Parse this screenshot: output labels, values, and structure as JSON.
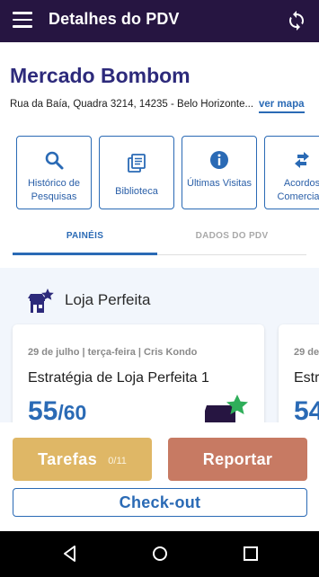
{
  "header": {
    "title": "Detalhes do PDV",
    "menu_icon": "menu-icon",
    "sync_icon": "sync-icon"
  },
  "store": {
    "name": "Mercado Bombom",
    "address": "Rua da Baía, Quadra 3214, 14235 - Belo Horizonte...",
    "map_link": "ver mapa"
  },
  "actions": [
    {
      "icon": "search-icon",
      "label": "Histórico de Pesquisas"
    },
    {
      "icon": "library-icon",
      "label": "Biblioteca"
    },
    {
      "icon": "info-icon",
      "label": "Últimas Visitas"
    },
    {
      "icon": "swap-icon",
      "label": "Acordos Comerciais"
    }
  ],
  "tabs": [
    {
      "label": "PAINÉIS",
      "active": true
    },
    {
      "label": "DADOS DO PDV",
      "active": false
    }
  ],
  "panel": {
    "section_title": "Loja Perfeita",
    "section_icon": "store-star-icon",
    "cards": [
      {
        "meta": "29 de julho | terça-feira | Cris Kondo",
        "name": "Estratégia de Loja Perfeita 1",
        "score": "55",
        "total": "/60"
      },
      {
        "meta": "29 de",
        "name": "Estr",
        "score": "54",
        "total": ""
      }
    ]
  },
  "buttons": {
    "tasks_label": "Tarefas",
    "tasks_count": "0/11",
    "report_label": "Reportar",
    "checkout_label": "Check-out"
  },
  "colors": {
    "appbar": "#261541",
    "accent": "#2a6ab5",
    "tasks": "#dfb766",
    "report": "#c77a63",
    "star": "#2fae5a"
  }
}
